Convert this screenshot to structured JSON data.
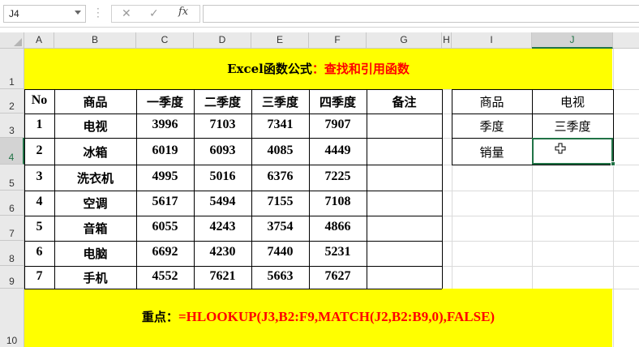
{
  "formula_bar": {
    "name_box": "J4",
    "fx_label": "fx",
    "cancel_glyph": "✕",
    "enter_glyph": "✓",
    "formula": ""
  },
  "columns": [
    "A",
    "B",
    "C",
    "D",
    "E",
    "F",
    "G",
    "H",
    "I",
    "J"
  ],
  "rows": [
    "1",
    "2",
    "3",
    "4",
    "5",
    "6",
    "7",
    "8",
    "9",
    "10"
  ],
  "selected_cell": "J4",
  "title": {
    "prefix": "Excel函数公式",
    "colon": "：",
    "suffix": "查找和引用函数"
  },
  "table": {
    "headers": [
      "No",
      "商品",
      "一季度",
      "二季度",
      "三季度",
      "四季度",
      "备注"
    ],
    "rows": [
      [
        "1",
        "电视",
        "3996",
        "7103",
        "7341",
        "7907",
        ""
      ],
      [
        "2",
        "冰箱",
        "6019",
        "6093",
        "4085",
        "4449",
        ""
      ],
      [
        "3",
        "洗衣机",
        "4995",
        "5016",
        "6376",
        "7225",
        ""
      ],
      [
        "4",
        "空调",
        "5617",
        "5494",
        "7155",
        "7108",
        ""
      ],
      [
        "5",
        "音箱",
        "6055",
        "4243",
        "3754",
        "4866",
        ""
      ],
      [
        "6",
        "电脑",
        "6692",
        "4230",
        "7440",
        "5231",
        ""
      ],
      [
        "7",
        "手机",
        "4552",
        "7621",
        "5663",
        "7627",
        ""
      ]
    ]
  },
  "lookup": {
    "rows": [
      [
        "商品",
        "电视"
      ],
      [
        "季度",
        "三季度"
      ],
      [
        "销量",
        ""
      ]
    ]
  },
  "key_point": {
    "label": "重点：",
    "formula": "=HLOOKUP(J3,B2:F9,MATCH(J2,B2:B9,0),FALSE)"
  },
  "colors": {
    "banner": "#ffff00",
    "accent_red": "#ff0000",
    "selection_green": "#217346"
  }
}
